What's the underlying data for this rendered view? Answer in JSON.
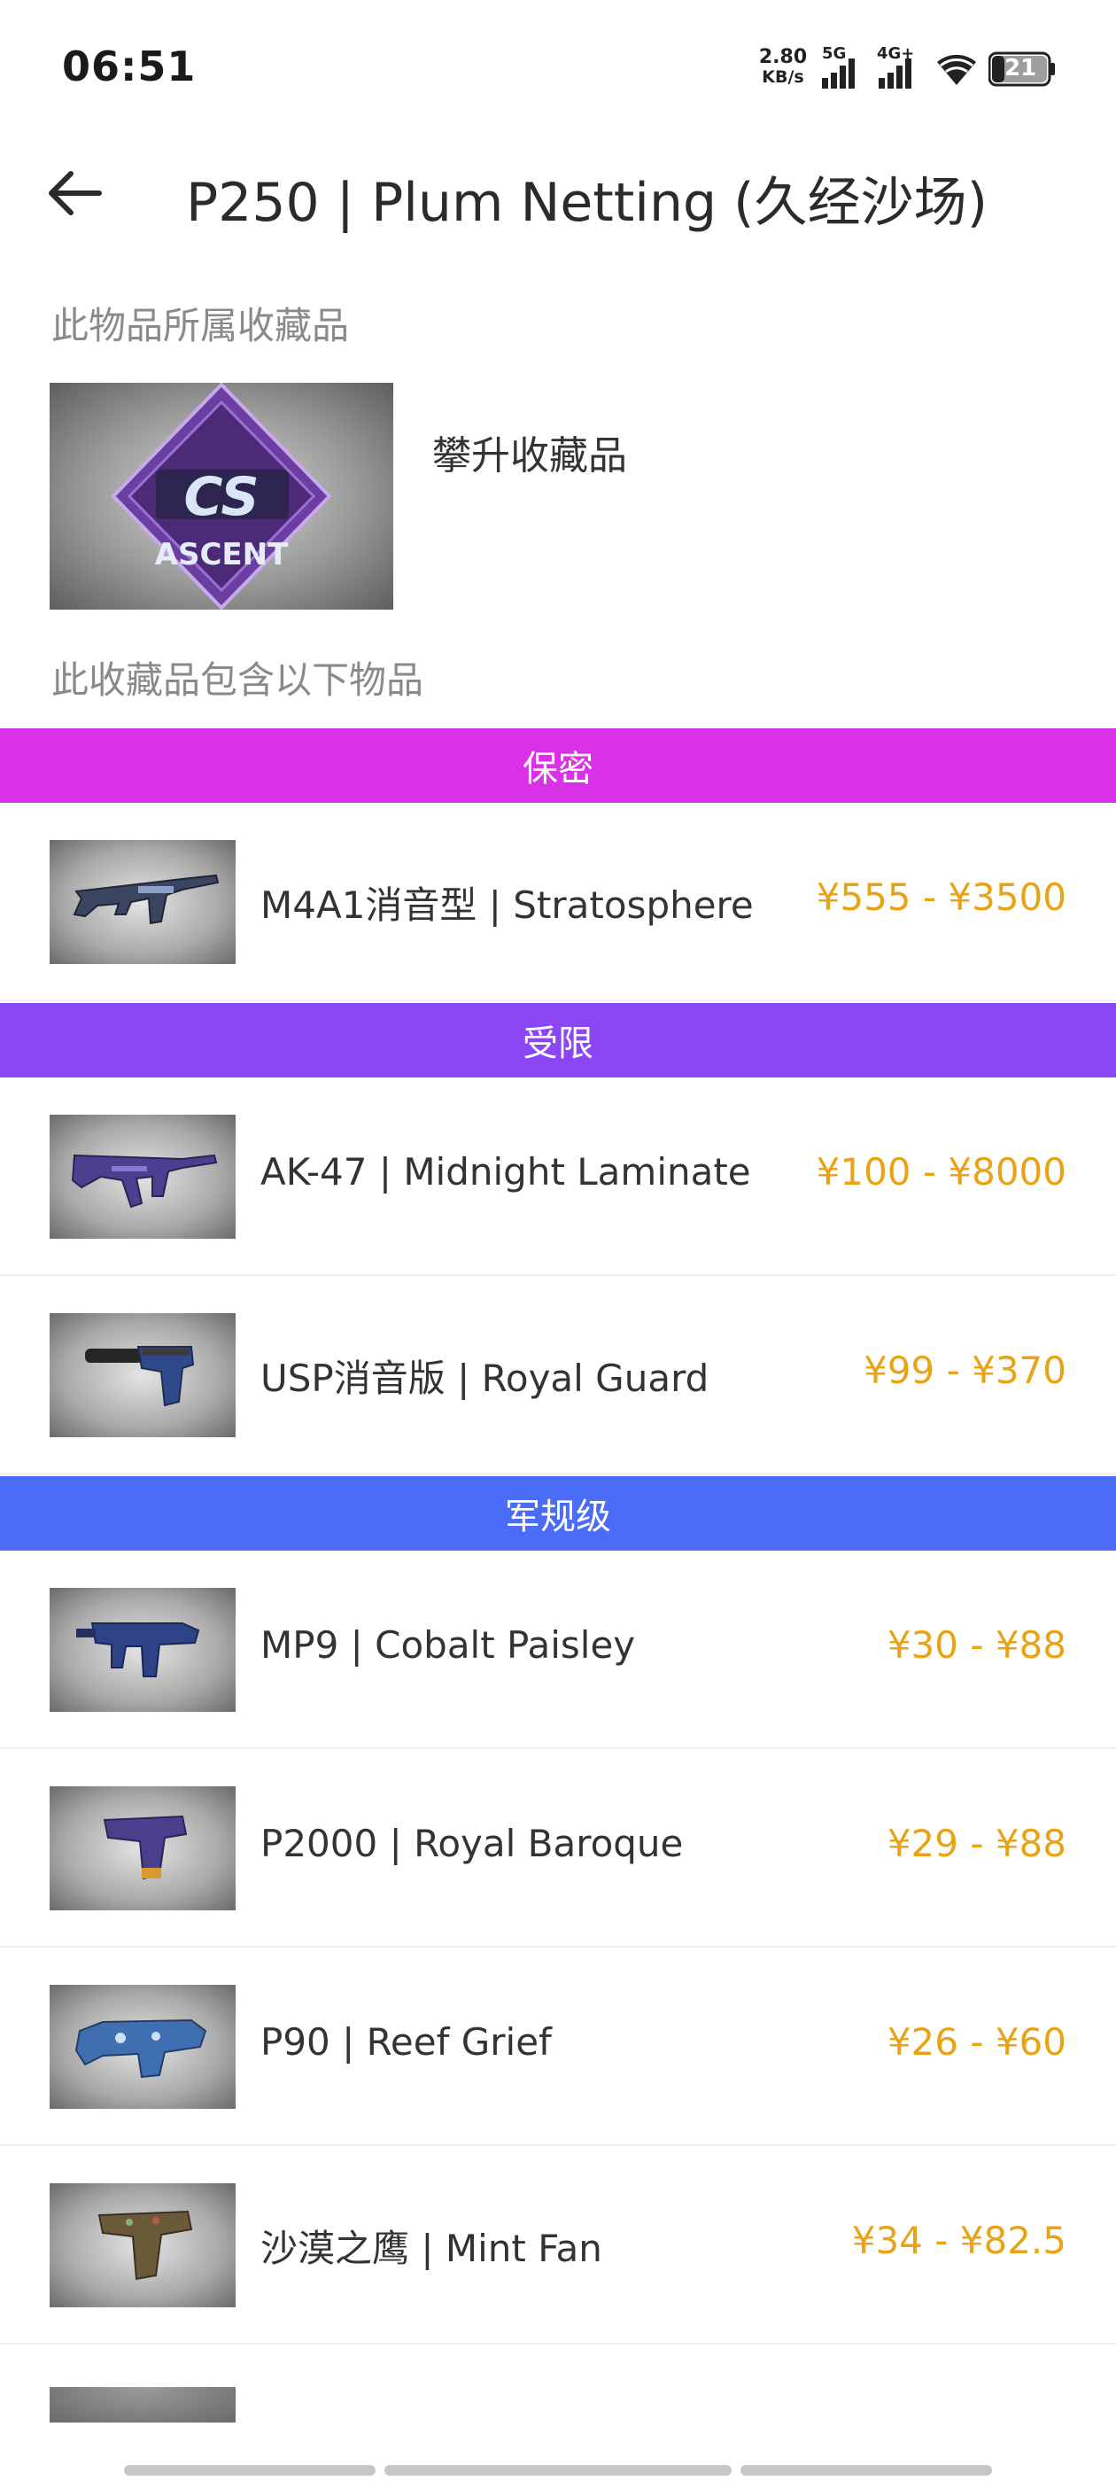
{
  "status_bar": {
    "time": "06:51",
    "net_speed_value": "2.80",
    "net_speed_unit": "KB/s",
    "sig1_label": "5G",
    "sig2_label": "4G+",
    "battery_level": "21"
  },
  "header": {
    "title": "P250 | Plum Netting (久经沙场)"
  },
  "collection": {
    "section_label": "此物品所属收藏品",
    "name": "攀升收藏品",
    "logo_text": "CS",
    "logo_subtext": "ASCENT"
  },
  "contents": {
    "section_label": "此收藏品包含以下物品",
    "groups": [
      {
        "rarity": "保密",
        "color": "#d932e6",
        "items": [
          {
            "name": "M4A1消音型 | Stratosphere",
            "price": "¥555 - ¥3500"
          }
        ]
      },
      {
        "rarity": "受限",
        "color": "#8b46f5",
        "items": [
          {
            "name": "AK-47 | Midnight Laminate",
            "price": "¥100 - ¥8000"
          },
          {
            "name": "USP消音版 | Royal Guard",
            "price": "¥99 - ¥370"
          }
        ]
      },
      {
        "rarity": "军规级",
        "color": "#4a6cf7",
        "items": [
          {
            "name": "MP9 | Cobalt Paisley",
            "price": "¥30 - ¥88"
          },
          {
            "name": "P2000 | Royal Baroque",
            "price": "¥29 - ¥88"
          },
          {
            "name": "P90 | Reef Grief",
            "price": "¥26 - ¥60"
          },
          {
            "name": "沙漠之鹰 | Mint Fan",
            "price": "¥34 - ¥82.5"
          }
        ]
      }
    ]
  }
}
